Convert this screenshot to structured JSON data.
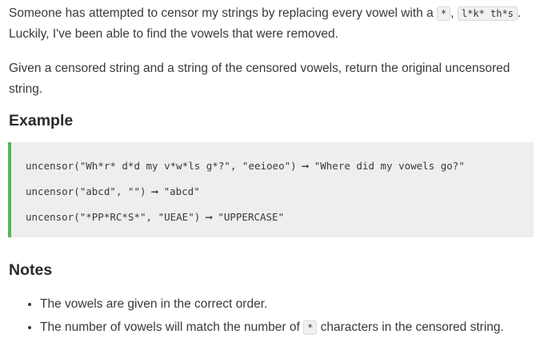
{
  "intro": {
    "line1_prefix": "Someone has attempted to censor my strings by replacing every vowel with a ",
    "code_star": "*",
    "line1_comma": ", ",
    "code_example": "l*k* th*s",
    "line1_suffix": ".",
    "line2": "Luckily, I've been able to find the vowels that were removed."
  },
  "task": {
    "text": "Given a censored string and a string of the censored vowels, return the original uncensored string."
  },
  "example": {
    "heading": "Example",
    "arrow": "➞",
    "lines": [
      {
        "call": "uncensor(\"Wh*r* d*d my v*w*ls g*?\", \"eeioeo\")",
        "result": "\"Where did my vowels go?\""
      },
      {
        "call": "uncensor(\"abcd\", \"\")",
        "result": "\"abcd\""
      },
      {
        "call": "uncensor(\"*PP*RC*S*\", \"UEAE\")",
        "result": "\"UPPERCASE\""
      }
    ]
  },
  "notes": {
    "heading": "Notes",
    "item1": "The vowels are given in the correct order.",
    "item2_prefix": "The number of vowels will match the number of ",
    "item2_code": "*",
    "item2_suffix": " characters in the censored string."
  }
}
